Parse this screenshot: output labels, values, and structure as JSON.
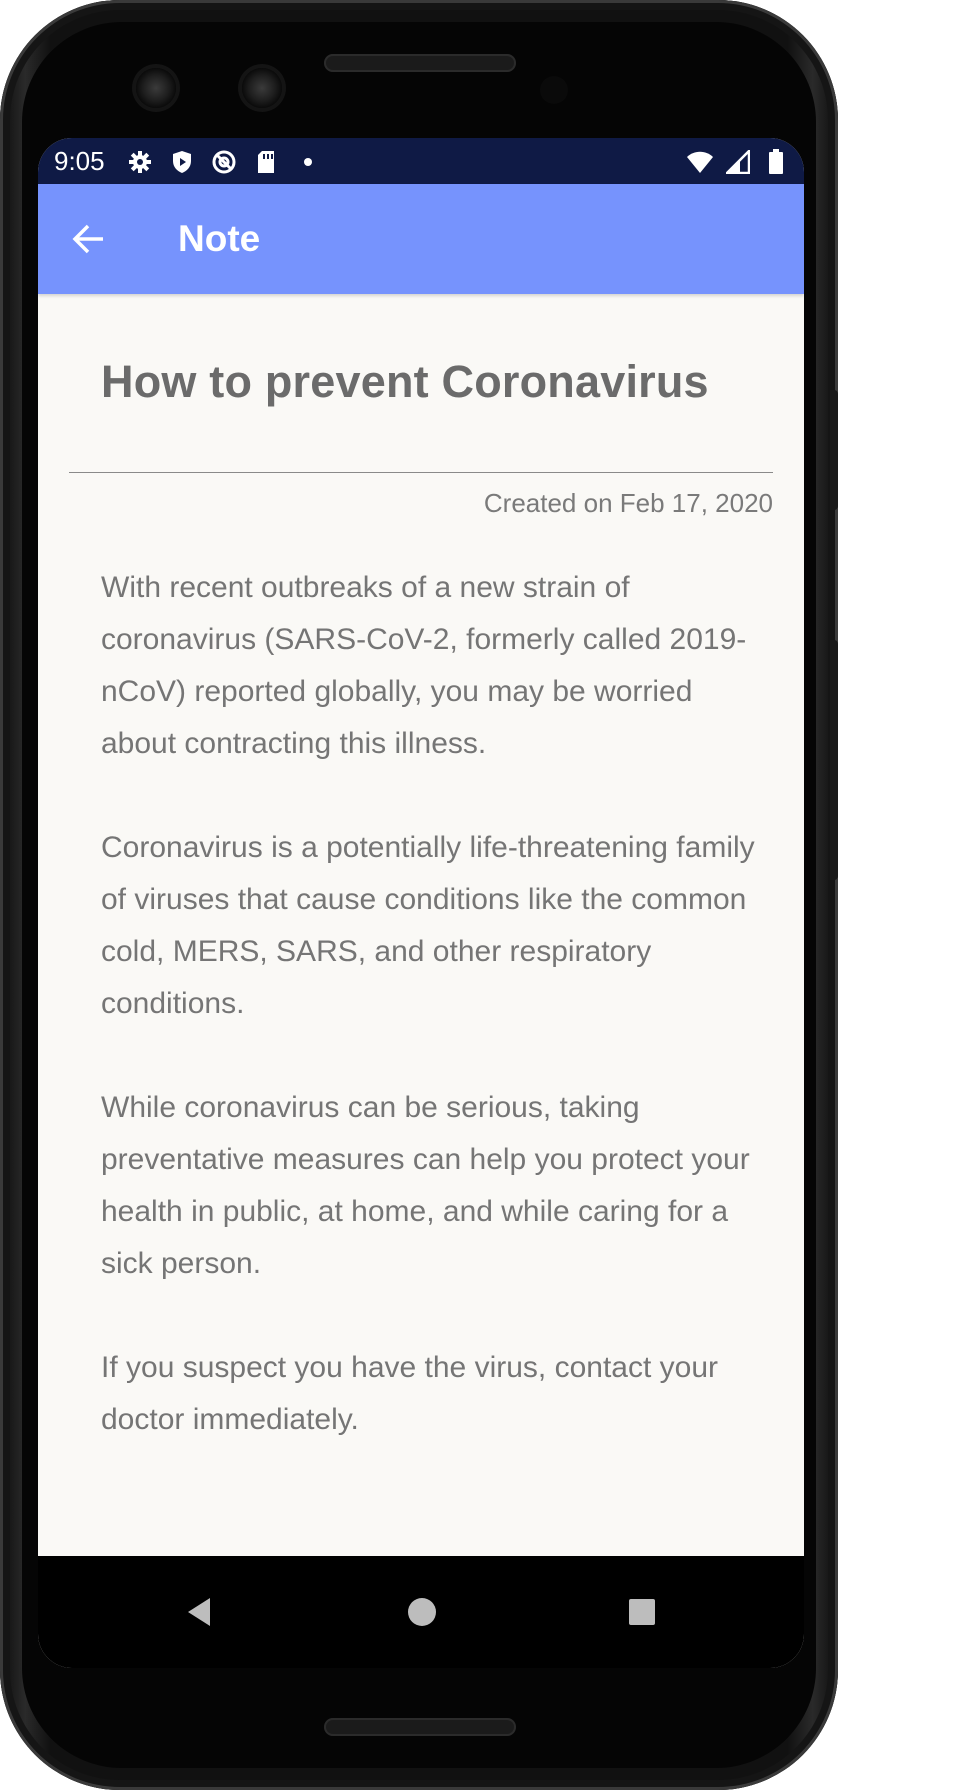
{
  "status_bar": {
    "time": "9:05",
    "left_icons": [
      "settings-icon",
      "shield-icon",
      "at-sign-icon",
      "sd-card-icon",
      "dot-icon"
    ],
    "right_icons": [
      "wifi-icon",
      "signal-icon",
      "battery-icon"
    ]
  },
  "app_bar": {
    "title": "Note",
    "back_icon": "arrow-back-icon",
    "color": "#7693fd"
  },
  "note": {
    "title": "How to prevent Coronavirus",
    "created": "Created on Feb 17, 2020",
    "paragraphs": [
      "With recent outbreaks of a new strain of coronavirus (SARS-CoV-2, formerly called 2019-nCoV) reported globally, you may be worried about contracting this illness.",
      "Coronavirus is a potentially life-threatening family of viruses that cause conditions like the common cold, MERS, SARS, and other respiratory conditions.",
      "While coronavirus can be serious, taking preventative measures can help you protect your health in public, at home, and while caring for a sick person.",
      "If you suspect you have the virus, contact your doctor immediately."
    ]
  },
  "nav_bar": {
    "buttons": [
      "back-triangle-icon",
      "home-circle-icon",
      "recents-square-icon"
    ]
  }
}
